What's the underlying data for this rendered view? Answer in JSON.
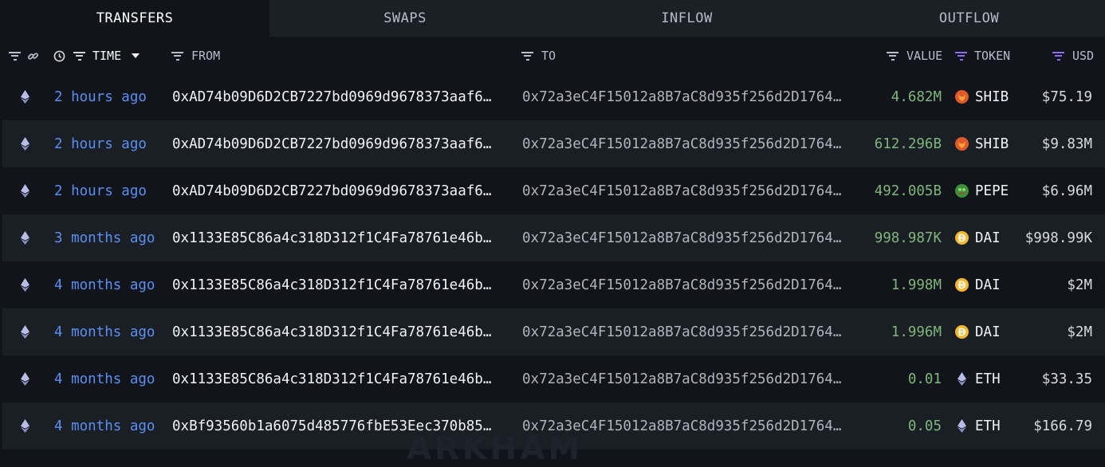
{
  "tabs": [
    {
      "label": "TRANSFERS",
      "active": true
    },
    {
      "label": "SWAPS",
      "active": false
    },
    {
      "label": "INFLOW",
      "active": false
    },
    {
      "label": "OUTFLOW",
      "active": false
    }
  ],
  "columns": {
    "time": "TIME",
    "from": "FROM",
    "to": "TO",
    "value": "VALUE",
    "token": "TOKEN",
    "usd": "USD"
  },
  "rows": [
    {
      "time": "2 hours ago",
      "from": "0xAD74b09D6D2CB7227bd0969d9678373aaf6…",
      "to": "0x72a3eC4F15012a8B7aC8d935f256d2D1764…",
      "value": "4.682M",
      "token": "SHIB",
      "token_icon": "shib-icon",
      "usd": "$75.19"
    },
    {
      "time": "2 hours ago",
      "from": "0xAD74b09D6D2CB7227bd0969d9678373aaf6…",
      "to": "0x72a3eC4F15012a8B7aC8d935f256d2D1764…",
      "value": "612.296B",
      "token": "SHIB",
      "token_icon": "shib-icon",
      "usd": "$9.83M"
    },
    {
      "time": "2 hours ago",
      "from": "0xAD74b09D6D2CB7227bd0969d9678373aaf6…",
      "to": "0x72a3eC4F15012a8B7aC8d935f256d2D1764…",
      "value": "492.005B",
      "token": "PEPE",
      "token_icon": "pepe-icon",
      "usd": "$6.96M"
    },
    {
      "time": "3 months ago",
      "from": "0x1133E85C86a4c318D312f1C4Fa78761e46b…",
      "to": "0x72a3eC4F15012a8B7aC8d935f256d2D1764…",
      "value": "998.987K",
      "token": "DAI",
      "token_icon": "dai-icon",
      "usd": "$998.99K"
    },
    {
      "time": "4 months ago",
      "from": "0x1133E85C86a4c318D312f1C4Fa78761e46b…",
      "to": "0x72a3eC4F15012a8B7aC8d935f256d2D1764…",
      "value": "1.998M",
      "token": "DAI",
      "token_icon": "dai-icon",
      "usd": "$2M"
    },
    {
      "time": "4 months ago",
      "from": "0x1133E85C86a4c318D312f1C4Fa78761e46b…",
      "to": "0x72a3eC4F15012a8B7aC8d935f256d2D1764…",
      "value": "1.996M",
      "token": "DAI",
      "token_icon": "dai-icon",
      "usd": "$2M"
    },
    {
      "time": "4 months ago",
      "from": "0x1133E85C86a4c318D312f1C4Fa78761e46b…",
      "to": "0x72a3eC4F15012a8B7aC8d935f256d2D1764…",
      "value": "0.01",
      "token": "ETH",
      "token_icon": "eth-icon",
      "usd": "$33.35"
    },
    {
      "time": "4 months ago",
      "from": "0xBf93560b1a6075d485776fbE53Eec370b85…",
      "to": "0x72a3eC4F15012a8B7aC8d935f256d2D1764…",
      "value": "0.05",
      "token": "ETH",
      "token_icon": "eth-icon",
      "usd": "$166.79"
    }
  ],
  "chain_icon": "ethereum-icon",
  "watermark": "ARKHAM",
  "colors": {
    "background": "#11141a",
    "row_alt": "#1a1e25",
    "time_link": "#5b8ff0",
    "value_green": "#7fb77a",
    "filter_active": "#8b6cf2"
  }
}
